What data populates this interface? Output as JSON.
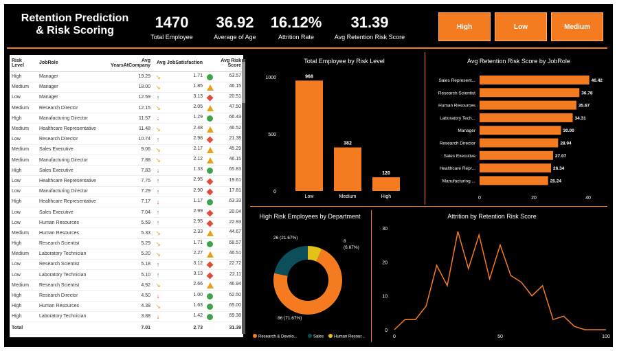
{
  "title": "Retention Prediction & Risk Scoring",
  "kpis": [
    {
      "value": "1470",
      "label": "Total Employee"
    },
    {
      "value": "36.92",
      "label": "Average of Age"
    },
    {
      "value": "16.12%",
      "label": "Attrition Rate"
    },
    {
      "value": "31.39",
      "label": "Avg Retention Risk Score"
    }
  ],
  "slicers": [
    "High",
    "Low",
    "Medium"
  ],
  "colors": {
    "accent": "#f47b20",
    "background": "#000000",
    "donut_sales": "#0b4f5a",
    "donut_hr": "#e3c21a"
  },
  "table": {
    "headers": [
      "Risk Level",
      "JobRole",
      "Avg YearsAtCompany",
      "Avg JobSatisfaction",
      "Avg Risk Score"
    ],
    "rows": [
      [
        "High",
        "Manager",
        "19.29",
        "1.71",
        "63.57",
        "side",
        "circle"
      ],
      [
        "Medium",
        "Manager",
        "18.00",
        "1.85",
        "46.15",
        "side",
        "triangle"
      ],
      [
        "Low",
        "Manager",
        "12.59",
        "3.13",
        "20.51",
        "up",
        "diamond"
      ],
      [
        "Medium",
        "Research Director",
        "12.15",
        "2.05",
        "47.50",
        "side",
        "triangle"
      ],
      [
        "High",
        "Manufacturing Director",
        "11.57",
        "1.29",
        "66.43",
        "down",
        "circle"
      ],
      [
        "Medium",
        "Healthcare Representative",
        "11.48",
        "2.48",
        "46.52",
        "side",
        "triangle"
      ],
      [
        "Low",
        "Research Director",
        "10.74",
        "2.98",
        "21.38",
        "up",
        "diamond"
      ],
      [
        "Medium",
        "Sales Executive",
        "9.06",
        "2.17",
        "45.29",
        "side",
        "triangle"
      ],
      [
        "Medium",
        "Manufacturing Director",
        "7.88",
        "2.12",
        "46.15",
        "side",
        "triangle"
      ],
      [
        "High",
        "Sales Executive",
        "7.83",
        "1.33",
        "65.83",
        "down",
        "circle"
      ],
      [
        "Low",
        "Healthcare Representative",
        "7.75",
        "2.95",
        "19.61",
        "up",
        "diamond"
      ],
      [
        "Low",
        "Manufacturing Director",
        "7.29",
        "2.90",
        "17.81",
        "up",
        "diamond"
      ],
      [
        "High",
        "Healthcare Representative",
        "7.17",
        "1.17",
        "63.33",
        "down",
        "circle"
      ],
      [
        "Low",
        "Sales Executive",
        "7.04",
        "2.99",
        "20.04",
        "up",
        "diamond"
      ],
      [
        "Low",
        "Human Resources",
        "5.59",
        "2.95",
        "22.93",
        "up",
        "diamond"
      ],
      [
        "Medium",
        "Human Resources",
        "5.33",
        "2.33",
        "44.67",
        "side",
        "triangle"
      ],
      [
        "High",
        "Research Scientist",
        "5.29",
        "1.71",
        "68.57",
        "side",
        "circle"
      ],
      [
        "Medium",
        "Laboratory Technician",
        "5.20",
        "2.27",
        "46.51",
        "side",
        "triangle"
      ],
      [
        "Low",
        "Research Scientist",
        "5.18",
        "3.12",
        "22.72",
        "up",
        "diamond"
      ],
      [
        "Low",
        "Laboratory Technician",
        "5.10",
        "3.13",
        "22.11",
        "up",
        "diamond"
      ],
      [
        "Medium",
        "Research Scientist",
        "4.92",
        "2.66",
        "46.94",
        "side",
        "triangle"
      ],
      [
        "High",
        "Research Director",
        "4.50",
        "1.00",
        "62.50",
        "down",
        "circle"
      ],
      [
        "High",
        "Human Resources",
        "4.38",
        "1.63",
        "65.00",
        "side",
        "circle"
      ],
      [
        "High",
        "Laboratory Technician",
        "3.88",
        "1.42",
        "69.38",
        "down",
        "circle"
      ]
    ],
    "total": [
      "Total",
      "",
      "7.01",
      "2.73",
      "31.39"
    ]
  },
  "chart_data": [
    {
      "type": "bar",
      "title": "Total Employee by Risk Level",
      "categories": [
        "Low",
        "Medium",
        "High"
      ],
      "values": [
        968,
        382,
        120
      ],
      "ylim": [
        0,
        1000
      ],
      "yticks": [
        0,
        500,
        1000
      ]
    },
    {
      "type": "bar",
      "orientation": "horizontal",
      "title": "Avg Retention Risk Score  by JobRole",
      "categories": [
        "Sales Represent...",
        "Research Scientist",
        "Human Resources",
        "Laboratory Tech...",
        "Manager",
        "Research Director",
        "Sales Executive",
        "Healthcare Repr...",
        "Manufacturing ..."
      ],
      "values": [
        40.42,
        36.78,
        35.67,
        34.31,
        30.0,
        28.94,
        27.07,
        26.34,
        25.24
      ],
      "xlim": [
        0,
        40
      ],
      "xticks": [
        0,
        20,
        40
      ]
    },
    {
      "type": "pie",
      "title": "High Risk Employees by Department",
      "labels": [
        "Research & Develo...",
        "Sales",
        "Human Resour..."
      ],
      "values": [
        86,
        26,
        8
      ],
      "slice_labels": [
        "86 (71.67%)",
        "26 (21.67%)",
        "8 (6.67%)"
      ],
      "colors": [
        "#f47b20",
        "#0b4f5a",
        "#e3c21a"
      ]
    },
    {
      "type": "line",
      "title": "Attrition by Retention Risk Score",
      "x": [
        0,
        5,
        10,
        15,
        20,
        25,
        30,
        35,
        40,
        45,
        50,
        55,
        60,
        65,
        70,
        75,
        80,
        85,
        90,
        95,
        100
      ],
      "y": [
        0,
        3,
        3,
        7,
        19,
        13,
        29,
        18,
        28,
        15,
        25,
        16,
        14,
        10,
        13,
        3,
        4,
        1,
        0,
        0,
        0
      ],
      "xlim": [
        0,
        100
      ],
      "ylim": [
        0,
        30
      ],
      "xticks": [
        0,
        50,
        100
      ],
      "yticks": [
        0,
        10,
        20,
        30
      ]
    }
  ]
}
